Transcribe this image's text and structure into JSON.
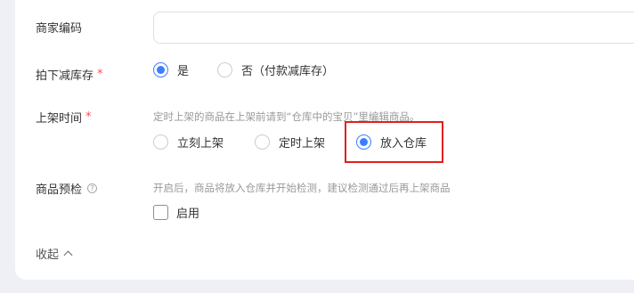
{
  "merchant_code": {
    "label": "商家编码",
    "value": "",
    "placeholder": ""
  },
  "stock_deduction": {
    "label": "拍下减库存",
    "required_mark": "*",
    "options": [
      {
        "label": "是",
        "checked": true
      },
      {
        "label": "否（付款减库存）",
        "checked": false
      }
    ]
  },
  "listing_time": {
    "label": "上架时间",
    "required_mark": "*",
    "hint": "定时上架的商品在上架前请到“仓库中的宝贝”里编辑商品。",
    "options": [
      {
        "label": "立刻上架",
        "checked": false
      },
      {
        "label": "定时上架",
        "checked": false
      },
      {
        "label": "放入仓库",
        "checked": true
      }
    ]
  },
  "pre_check": {
    "label": "商品预检",
    "help_glyph": "?",
    "hint": "开启后，商品将放入仓库并开始检测，建议检测通过后再上架商品",
    "checkbox_label": "启用",
    "checkbox_checked": false
  },
  "collapse": {
    "label": "收起"
  },
  "colors": {
    "accent": "#3d7eff",
    "required": "#ff4d4f",
    "highlight": "#e0201b"
  }
}
